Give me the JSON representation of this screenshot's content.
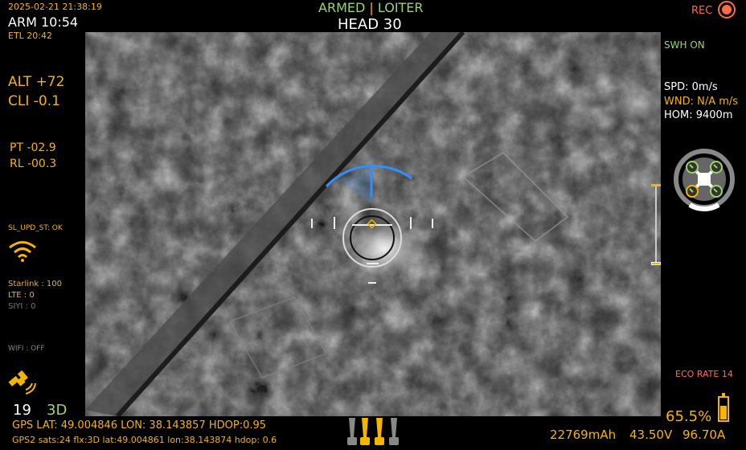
{
  "top_left": {
    "datetime": "2025-02-21 21:38:19",
    "arm_time": "ARM 10:54",
    "etl": "ETL 20:42"
  },
  "top_center": {
    "armed": "ARMED",
    "separator": "|",
    "mode": "LOITER",
    "heading": "HEAD  30"
  },
  "top_right": {
    "rec_label": "REC",
    "swh": "SWH ON"
  },
  "left_panel": {
    "alt": "ALT +72",
    "cli": "CLI -0.1",
    "pt": "PT -02.9",
    "rl": "RL -00.3",
    "sl_status": "SL_UPD_ST: OK",
    "starlink": "Starlink : 100",
    "lte": "LTE : 0",
    "siyi": "SIYI : 0",
    "wifi": "WIFI : OFF",
    "sats": "19",
    "fix": "3D"
  },
  "right_panel": {
    "spd": "SPD:  0m/s",
    "wnd": "WND: N/A m/s",
    "hom": "HOM: 9400m",
    "eco": "ECO RATE 14",
    "battery_pct": "65.5%",
    "battery_level": 0.655
  },
  "bottom": {
    "gps": "GPS LAT: 49.004846 LON: 38.143857    HDOP:0.95",
    "gps2": "GPS2 sats:24  flx:3D lat:49.004861 lon:38.143874 hdop: 0.6",
    "mah": "22769mAh",
    "volt": "43.50V",
    "amp": "96.70A"
  },
  "colors": {
    "accent": "#f4b400",
    "status_green": "#9ed36a",
    "rec_red": "#ff6a4a",
    "arc_blue": "#2f8fff"
  },
  "icons": [
    "record-icon",
    "wifi-icon",
    "satellite-icon",
    "drone-status-icon",
    "battery-icon",
    "motor-icons"
  ]
}
